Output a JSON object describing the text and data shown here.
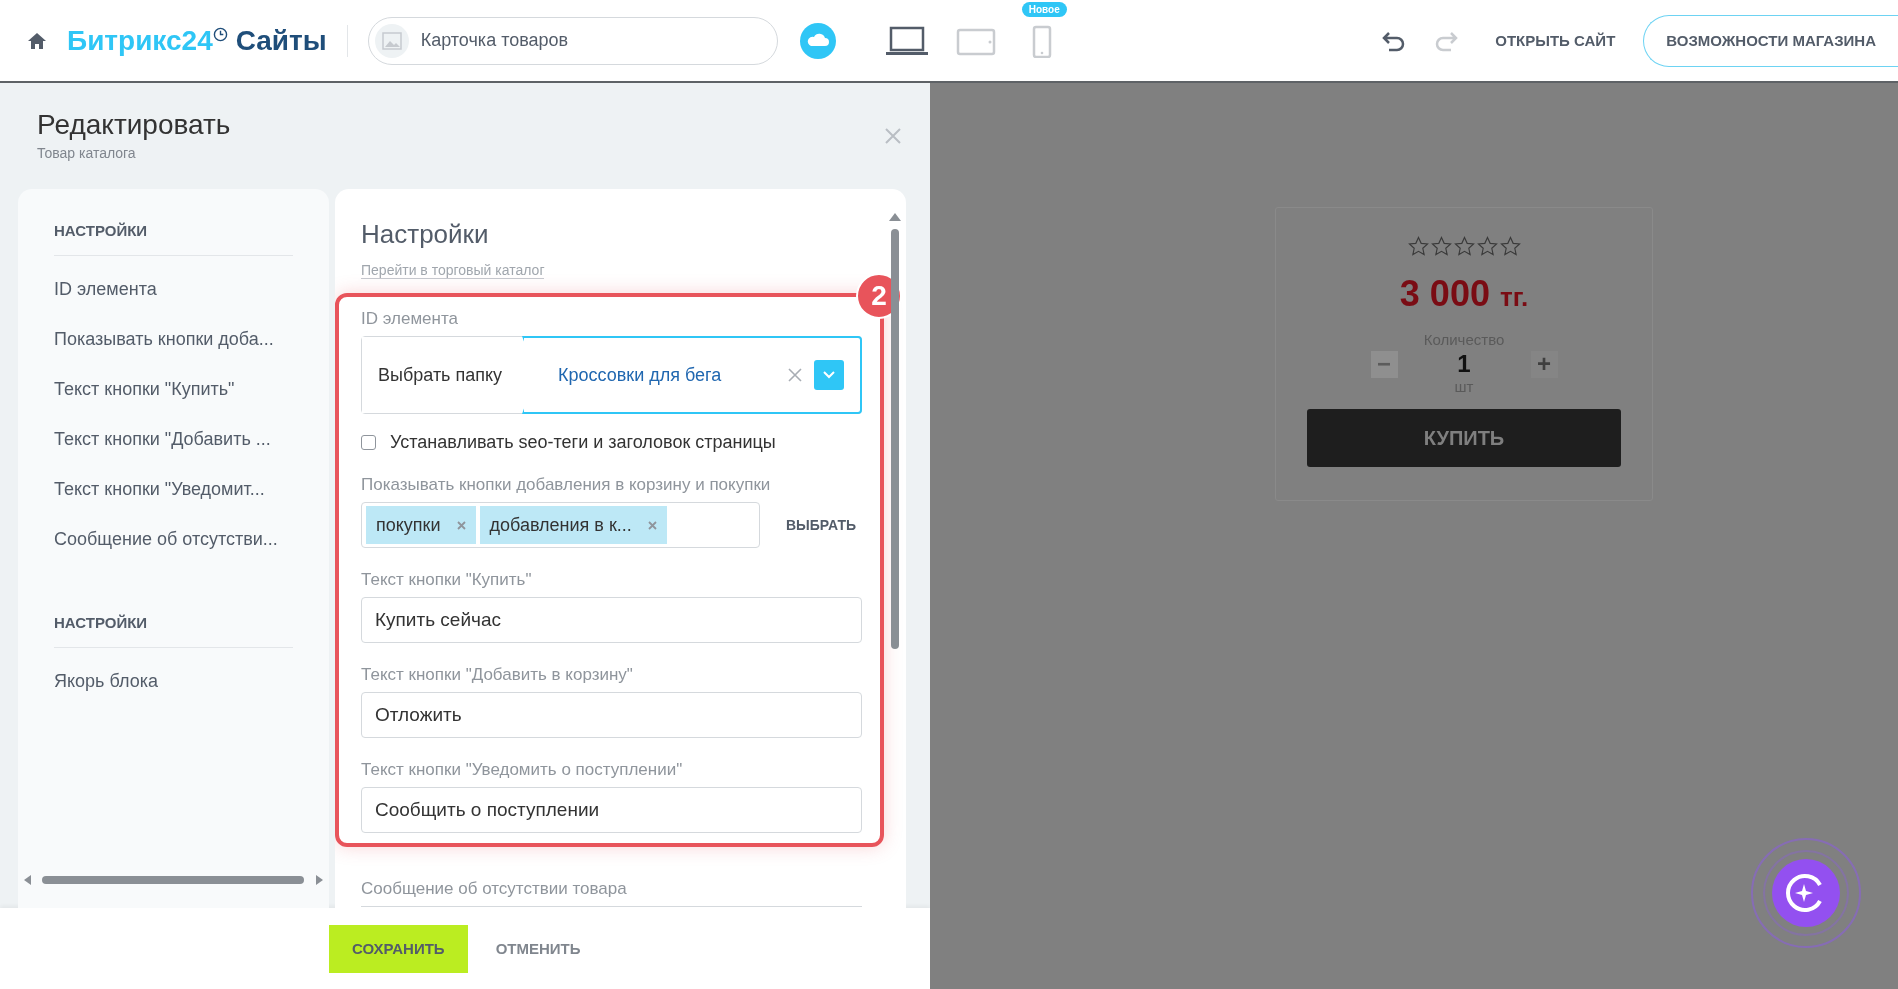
{
  "header": {
    "logo": {
      "brand": "Битрикс24",
      "product": "Сайты"
    },
    "page_selector": {
      "value": "Карточка товаров"
    },
    "devices": [
      {
        "kind": "desktop",
        "selected": true
      },
      {
        "kind": "tablet",
        "selected": false
      },
      {
        "kind": "mobile",
        "selected": false,
        "badge": "Новое"
      }
    ],
    "history": [
      {
        "kind": "undo",
        "disabled": false
      },
      {
        "kind": "redo",
        "disabled": true
      }
    ],
    "open_site": "ОТКРЫТЬ САЙТ",
    "store_features": "ВОЗМОЖНОСТИ МАГАЗИНА"
  },
  "editor": {
    "title": "Редактировать",
    "subtitle": "Товар каталога",
    "sidebar": [
      {
        "heading": "НАСТРОЙКИ",
        "items": [
          "ID элемента",
          "Показывать кнопки доба...",
          "Текст кнопки \"Купить\"",
          "Текст кнопки \"Добавить ...",
          "Текст кнопки \"Уведомит...",
          "Сообщение об отсутстви..."
        ]
      },
      {
        "heading": "НАСТРОЙКИ",
        "items": [
          "Якорь блока"
        ]
      }
    ],
    "settings": {
      "title": "Настройки",
      "catalog_link": "Перейти в торговый каталог",
      "highlight": {
        "badge": "2",
        "fields": [
          {
            "kind": "picker",
            "label": "ID элемента",
            "folder_button": "Выбрать папку",
            "value": "Кроссовки для бега"
          },
          {
            "kind": "checkbox",
            "label": "Устанавливать seo-теги и заголовок страницы",
            "checked": false
          },
          {
            "kind": "tags",
            "label": "Показывать кнопки добавления в корзину и покупки",
            "tags": [
              "покупки",
              "добавления в к..."
            ],
            "action": "ВЫБРАТЬ"
          },
          {
            "kind": "text",
            "label": "Текст кнопки \"Купить\"",
            "value": "Купить сейчас"
          },
          {
            "kind": "text",
            "label": "Текст кнопки \"Добавить в корзину\"",
            "value": "Отложить"
          },
          {
            "kind": "text",
            "label": "Текст кнопки \"Уведомить о поступлении\"",
            "value": "Сообщить о поступлении"
          }
        ]
      },
      "more_fields": [
        {
          "kind": "text",
          "label": "Сообщение об отсутствии товара"
        }
      ]
    },
    "save": "СОХРАНИТЬ",
    "cancel": "ОТМЕНИТЬ"
  },
  "preview": {
    "product": {
      "stars": 0,
      "price": "3 000",
      "currency": "тг.",
      "quantity_label": "Количество",
      "minus": "−",
      "quantity": "1",
      "plus": "+",
      "unit": "шт",
      "buy": "КУПИТЬ"
    }
  }
}
